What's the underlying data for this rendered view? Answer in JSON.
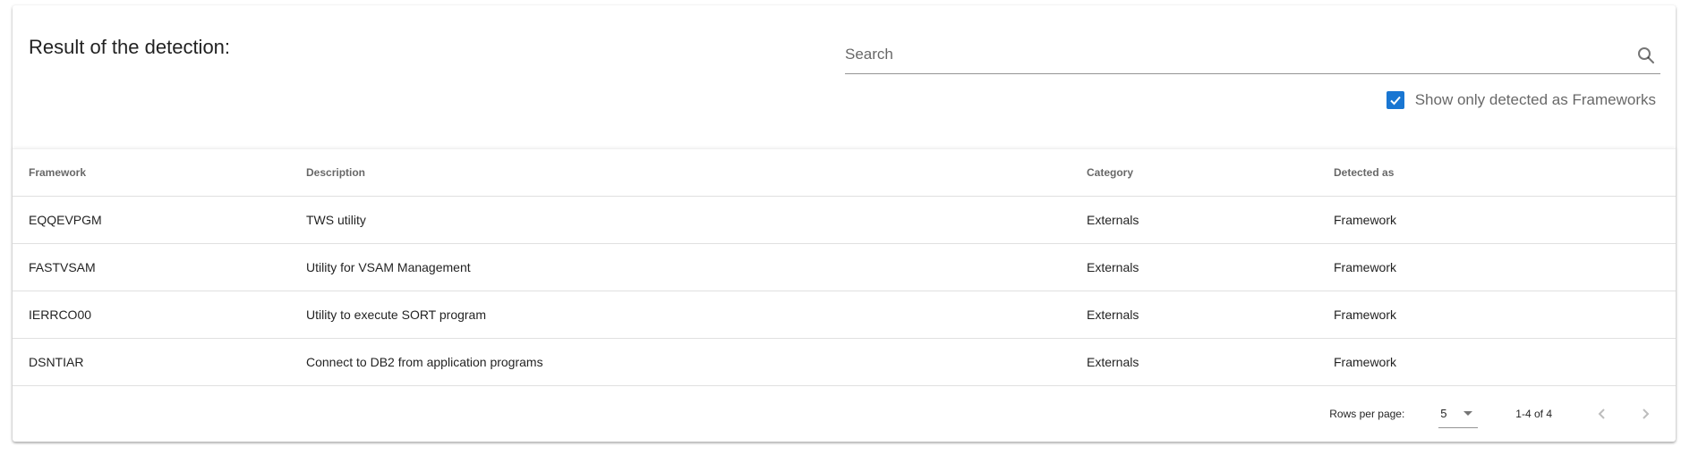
{
  "header": {
    "title": "Result of the detection:"
  },
  "search": {
    "placeholder": "Search",
    "value": ""
  },
  "filter": {
    "checked": true,
    "label": "Show only detected as Frameworks"
  },
  "table": {
    "columns": [
      "Framework",
      "Description",
      "Category",
      "Detected as"
    ],
    "rows": [
      {
        "framework": "EQQEVPGM",
        "description": "TWS utility",
        "category": "Externals",
        "detected_as": "Framework"
      },
      {
        "framework": "FASTVSAM",
        "description": "Utility for VSAM Management",
        "category": "Externals",
        "detected_as": "Framework"
      },
      {
        "framework": "IERRCO00",
        "description": "Utility to execute SORT program",
        "category": "Externals",
        "detected_as": "Framework"
      },
      {
        "framework": "DSNTIAR",
        "description": "Connect to DB2 from application programs",
        "category": "Externals",
        "detected_as": "Framework"
      }
    ]
  },
  "pagination": {
    "rows_per_page_label": "Rows per page:",
    "rows_per_page_value": "5",
    "range_text": "1-4 of 4"
  },
  "icons": {
    "search": "search-icon",
    "checkbox": "check-icon",
    "dropdown": "caret-down-icon",
    "prev": "chevron-left-icon",
    "next": "chevron-right-icon"
  },
  "colors": {
    "accent": "#1976d2"
  }
}
